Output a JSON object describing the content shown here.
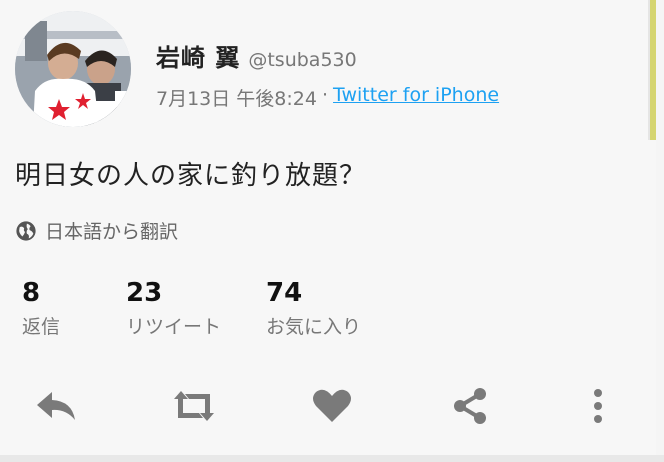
{
  "user": {
    "display_name": "岩崎 翼",
    "handle": "@tsuba530"
  },
  "meta": {
    "date": "7月13日 午後8:24",
    "separator": "·",
    "source": "Twitter for iPhone"
  },
  "tweet": {
    "text": "明日女の人の家に釣り放題？",
    "translate_label": "日本語から翻訳"
  },
  "stats": {
    "replies": {
      "count": "8",
      "label": "返信"
    },
    "retweets": {
      "count": "23",
      "label": "リツイート"
    },
    "likes": {
      "count": "74",
      "label": "お気に入り"
    }
  },
  "actions": [
    "reply-icon",
    "retweet-icon",
    "heart-icon",
    "share-icon",
    "more-vertical-icon"
  ],
  "colors": {
    "link": "#1da1f2",
    "icon": "#7a7a7a",
    "background": "#f7f7f7"
  }
}
